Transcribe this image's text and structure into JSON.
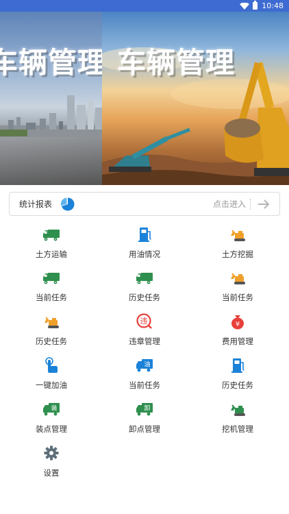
{
  "status_bar": {
    "time": "10:48",
    "icons": [
      "wifi-icon",
      "battery-icon"
    ]
  },
  "banner": {
    "title_left": "车辆管理",
    "title_right": "车辆管理"
  },
  "report": {
    "label": "统计报表",
    "enter_text": "点击进入",
    "icon": "pie-chart-icon"
  },
  "colors": {
    "status_bar": "#3d6bd1",
    "green": "#2f8f4e",
    "blue": "#1a82d8",
    "orange": "#f0a02a",
    "red": "#e8403a",
    "gray": "#5f6f7a"
  },
  "menu": [
    {
      "label": "土方运输",
      "icon": "truck-icon",
      "color": "#2f8f4e"
    },
    {
      "label": "用油情况",
      "icon": "fuel-pump-icon",
      "color": "#1a82d8"
    },
    {
      "label": "土方挖掘",
      "icon": "excavator-icon",
      "color": "#f0a02a"
    },
    {
      "label": "当前任务",
      "icon": "truck-icon",
      "color": "#2f8f4e"
    },
    {
      "label": "历史任务",
      "icon": "truck-icon",
      "color": "#2f8f4e"
    },
    {
      "label": "当前任务",
      "icon": "excavator-icon",
      "color": "#f0a02a"
    },
    {
      "label": "历史任务",
      "icon": "excavator-icon",
      "color": "#f0a02a"
    },
    {
      "label": "违章管理",
      "icon": "violation-icon",
      "color": "#e8403a",
      "badge": "违"
    },
    {
      "label": "费用管理",
      "icon": "money-bag-icon",
      "color": "#e8403a",
      "badge": "¥"
    },
    {
      "label": "一键加油",
      "icon": "tap-hand-icon",
      "color": "#1a82d8"
    },
    {
      "label": "当前任务",
      "icon": "fuel-truck-icon",
      "color": "#1a82d8",
      "badge": "油"
    },
    {
      "label": "历史任务",
      "icon": "fuel-pump-icon",
      "color": "#1a82d8"
    },
    {
      "label": "装点管理",
      "icon": "load-truck-icon",
      "color": "#2f8f4e",
      "badge": "装"
    },
    {
      "label": "卸点管理",
      "icon": "unload-truck-icon",
      "color": "#2f8f4e",
      "badge": "卸"
    },
    {
      "label": "挖机管理",
      "icon": "excavator-icon",
      "color": "#2f8f4e"
    },
    {
      "label": "设置",
      "icon": "gear-icon",
      "color": "#5f6f7a"
    }
  ]
}
